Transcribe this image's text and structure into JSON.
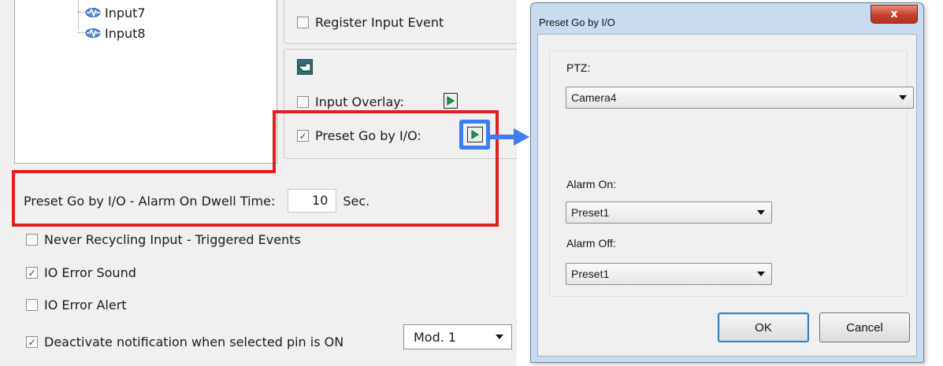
{
  "left_panel": {
    "tree": {
      "items": [
        {
          "label": "Input7",
          "icon": "io-wave-icon"
        },
        {
          "label": "Input8",
          "icon": "io-wave-icon"
        }
      ]
    },
    "register_input_event": {
      "label": "Register Input Event",
      "checked": false
    },
    "input_overlay": {
      "label": "Input Overlay:",
      "checked": false
    },
    "preset_go_by_io": {
      "label": "Preset Go by I/O:",
      "checked": true
    },
    "dwell": {
      "label": "Preset Go by I/O - Alarm On Dwell Time:",
      "value": "10",
      "unit": "Sec."
    },
    "never_recycling": {
      "label": "Never Recycling Input - Triggered Events",
      "checked": false
    },
    "io_error_sound": {
      "label": "IO Error Sound",
      "checked": true
    },
    "io_error_alert": {
      "label": "IO Error Alert",
      "checked": false
    },
    "deactivate_notification": {
      "label": "Deactivate notification when selected pin is ON",
      "checked": true
    },
    "mod_select": {
      "value": "Mod. 1"
    },
    "check_mark": "✓"
  },
  "dialog": {
    "title": "Preset Go by I/O",
    "close_glyph": "x",
    "ptz_label": "PTZ:",
    "ptz_value": "Camera4",
    "alarm_on_label": "Alarm On:",
    "alarm_on_value": "Preset1",
    "alarm_off_label": "Alarm Off:",
    "alarm_off_value": "Preset1",
    "ok_label": "OK",
    "cancel_label": "Cancel"
  },
  "colors": {
    "highlight_red": "#e02020",
    "highlight_blue": "#3a7ef0",
    "dialog_frame": "#c9dbef",
    "close_red": "#c4402a"
  }
}
